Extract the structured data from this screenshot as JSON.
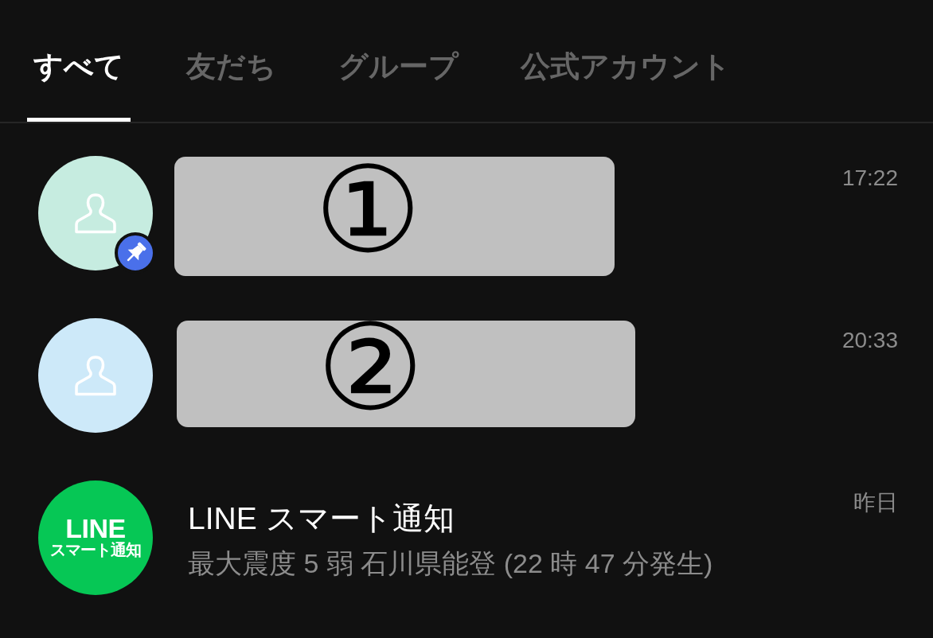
{
  "tabs": [
    {
      "label": "すべて",
      "selected": true
    },
    {
      "label": "友だち",
      "selected": false
    },
    {
      "label": "グループ",
      "selected": false
    },
    {
      "label": "公式アカウント",
      "selected": false
    }
  ],
  "chats": [
    {
      "kind": "redacted",
      "avatar": {
        "kind": "person",
        "color": "#c6ece0"
      },
      "pinned": true,
      "redaction": "①",
      "time": "17:22"
    },
    {
      "kind": "redacted",
      "avatar": {
        "kind": "person",
        "color": "#cde9f9"
      },
      "pinned": false,
      "redaction": "②",
      "time": "20:33"
    },
    {
      "kind": "message",
      "avatar": {
        "kind": "logo",
        "color": "#06c755",
        "lines": [
          "LINE",
          "スマート通知"
        ]
      },
      "pinned": false,
      "name": "LINE スマート通知",
      "preview": "最大震度 5 弱 石川県能登 (22 時 47 分発生)",
      "time": "昨日"
    }
  ]
}
